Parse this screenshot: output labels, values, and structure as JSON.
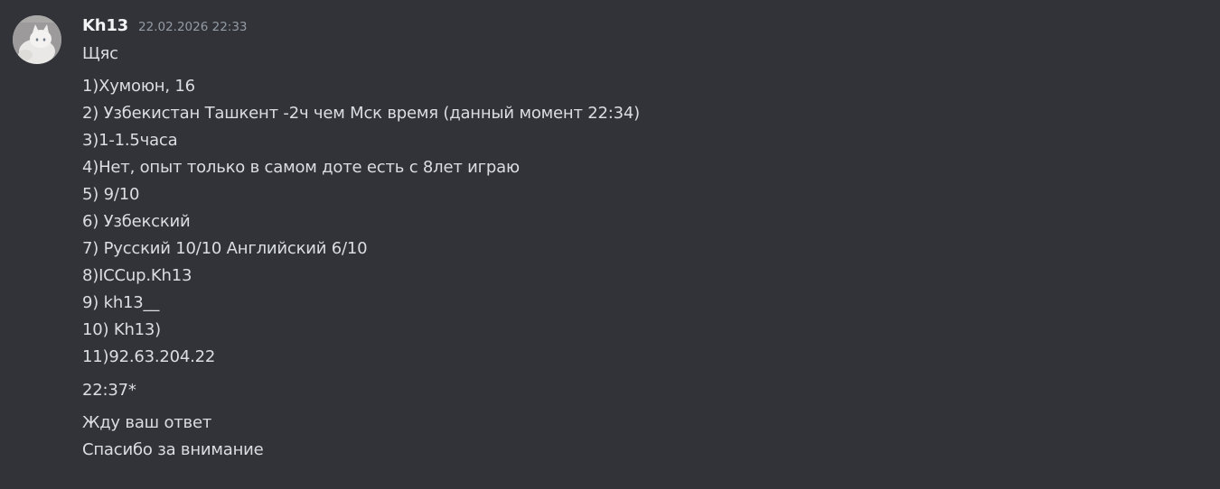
{
  "message": {
    "author": "Kh13",
    "timestamp": "22.02.2026 22:33",
    "avatar_icon": "white-cat-avatar",
    "lines": {
      "intro": "Щяс",
      "l1": "1)Хумоюн, 16",
      "l2": "2) Узбекистан Ташкент -2ч чем Мск время (данный момент 22:34)",
      "l3": "3)1-1.5часа",
      "l4": "4)Нет, опыт только в самом доте есть с 8лет играю",
      "l5": "5) 9/10",
      "l6": "6) Узбекский",
      "l7": "7) Русский 10/10 Английский 6/10",
      "l8": "8)ICCup.Kh13",
      "l9": "9) kh13__",
      "l10": "10) Kh13)",
      "l11": "11)92.63.204.22",
      "correction": "22:37*",
      "wait": "Жду ваш ответ",
      "thanks": "Спасибо за внимание"
    }
  },
  "colors": {
    "background": "#313338",
    "username": "#f2f3f5",
    "text": "#dbdee1",
    "timestamp": "#949ba4"
  }
}
